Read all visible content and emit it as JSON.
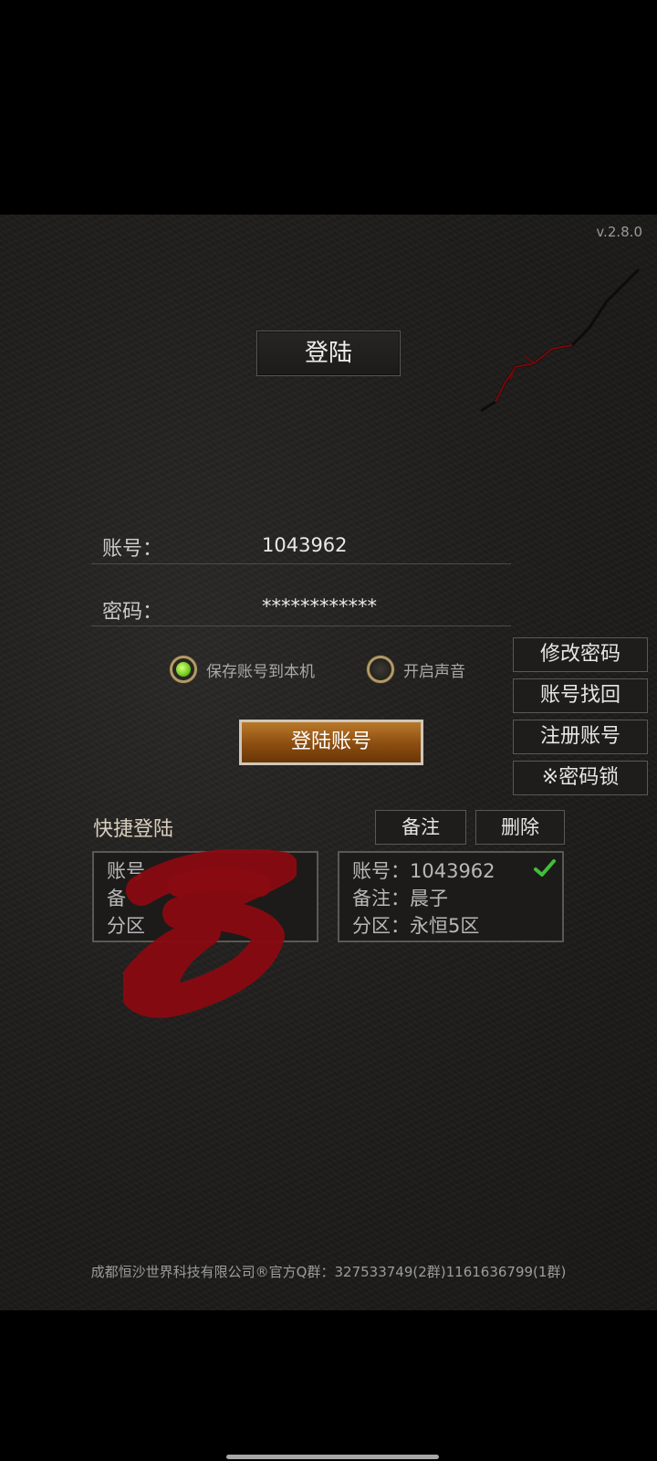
{
  "version": "v.2.8.0",
  "title": "登陆",
  "account": {
    "label": "账号：",
    "value": "1043962"
  },
  "password": {
    "label": "密码：",
    "value": "************"
  },
  "options": {
    "save_account": {
      "label": "保存账号到本机",
      "checked": true
    },
    "sound": {
      "label": "开启声音",
      "checked": false
    }
  },
  "side_buttons": [
    "修改密码",
    "账号找回",
    "注册账号",
    "※密码锁"
  ],
  "login_button": "登陆账号",
  "quick_login": {
    "title": "快捷登陆",
    "note_button": "备注",
    "delete_button": "删除",
    "cards": [
      {
        "rows": [
          "账号",
          "备",
          "分区"
        ],
        "redacted": true
      },
      {
        "rows": [
          "账号：1043962",
          "备注：晨子",
          "分区：永恒5区"
        ],
        "selected": true
      }
    ]
  },
  "footer": "成都恒沙世界科技有限公司®官方Q群：327533749(2群)1161636799(1群)",
  "colors": {
    "accent_green": "#6ecb1c",
    "button_orange": "#8b4d10",
    "redaction": "#8a0a12"
  }
}
